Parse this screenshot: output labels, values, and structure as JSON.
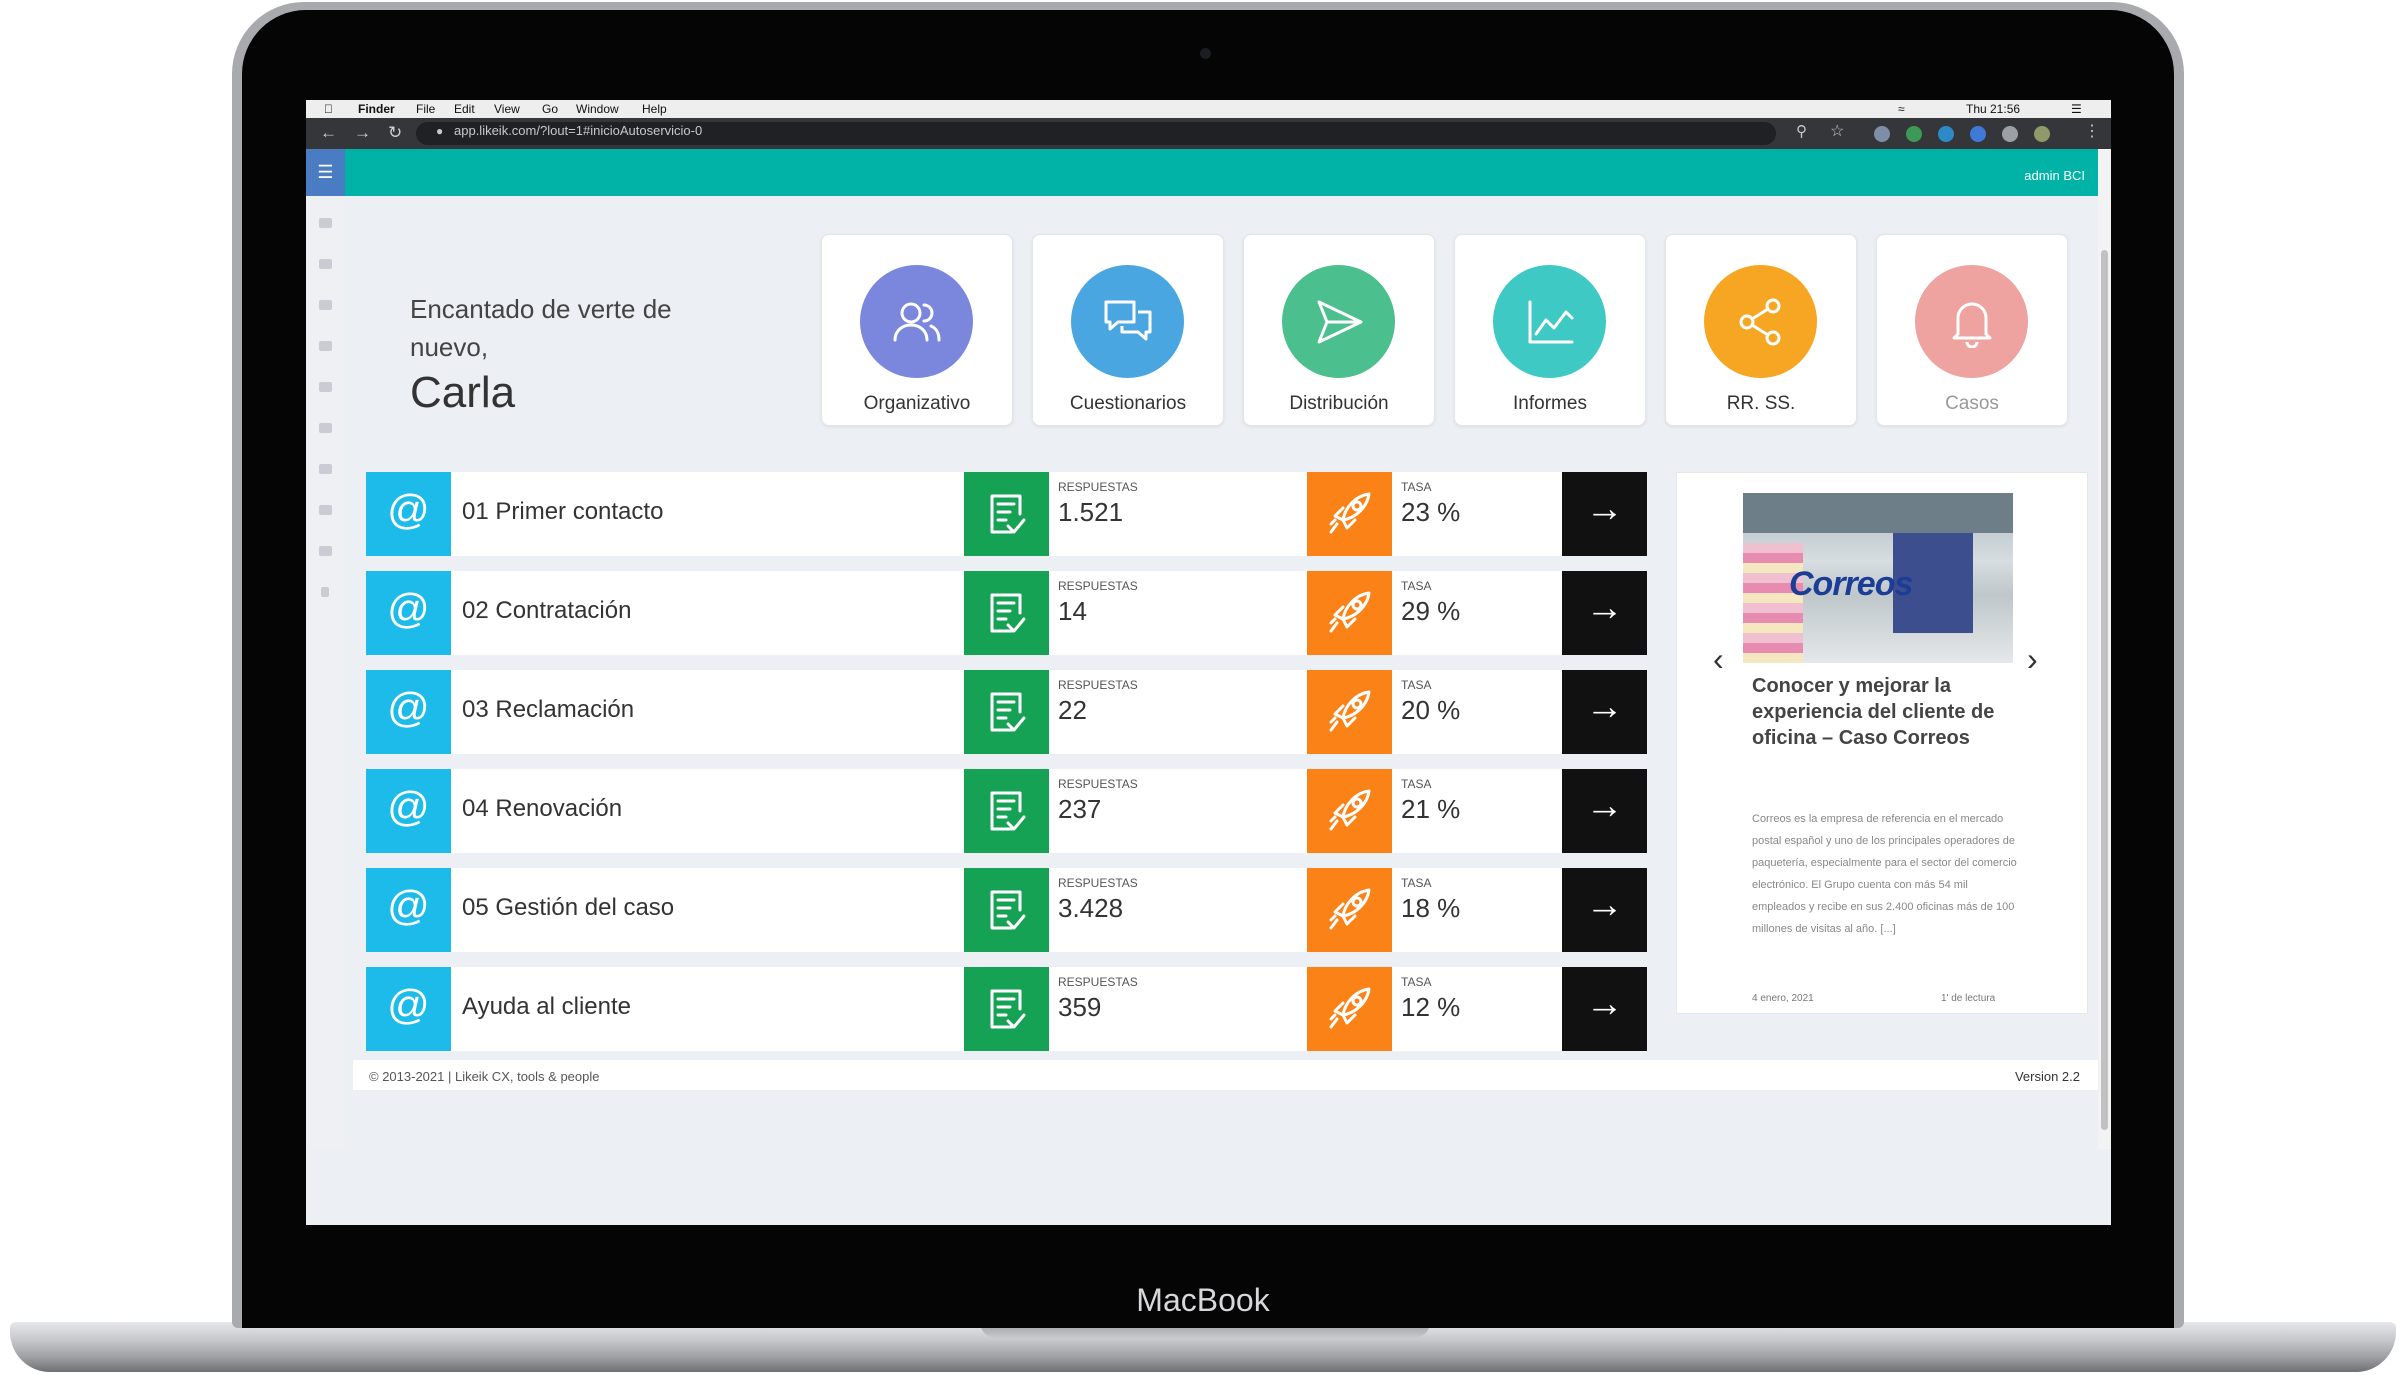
{
  "device": {
    "brand_label": "MacBook"
  },
  "macos_menu": {
    "items": [
      "Finder",
      "File",
      "Edit",
      "View",
      "Go",
      "Window",
      "Help"
    ],
    "clock": "Thu 21:56"
  },
  "browser": {
    "url": "app.likeik.com/?lout=1#inicioAutoservicio-0"
  },
  "header": {
    "user": "admin BCI",
    "accent_color": "#00b3a6"
  },
  "greeting": {
    "line": "Encantado de verte de nuevo,",
    "name": "Carla"
  },
  "tiles": [
    {
      "label": "Organizativo",
      "icon": "users-icon",
      "color": "#7b87dc"
    },
    {
      "label": "Cuestionarios",
      "icon": "chat-icon",
      "color": "#4aa6e0"
    },
    {
      "label": "Distribución",
      "icon": "send-icon",
      "color": "#4bbf8d"
    },
    {
      "label": "Informes",
      "icon": "chart-line-icon",
      "color": "#3fc9c5"
    },
    {
      "label": "RR. SS.",
      "icon": "share-icon",
      "color": "#f6a623"
    },
    {
      "label": "Casos",
      "icon": "bell-icon",
      "color": "#eea3a0",
      "disabled": true
    }
  ],
  "surveys": {
    "responses_label": "RESPUESTAS",
    "rate_label": "TASA",
    "rows": [
      {
        "name": "01 Primer contacto",
        "responses": "1.521",
        "rate": "23 %"
      },
      {
        "name": "02 Contratación",
        "responses": "14",
        "rate": "29 %"
      },
      {
        "name": "03 Reclamación",
        "responses": "22",
        "rate": "20 %"
      },
      {
        "name": "04 Renovación",
        "responses": "237",
        "rate": "21 %"
      },
      {
        "name": "05 Gestión del caso",
        "responses": "3.428",
        "rate": "18 %"
      },
      {
        "name": "Ayuda al cliente",
        "responses": "359",
        "rate": "12 %"
      }
    ]
  },
  "news": {
    "image_logo": "Correos",
    "title": "Conocer y mejorar la experiencia del cliente de oficina – Caso Correos",
    "excerpt": "Correos es la empresa de referencia en el mercado postal español y uno de los principales operadores de paquetería, especialmente para el sector del comercio electrónico. El Grupo cuenta con más 54 mil empleados y recibe en sus 2.400 oficinas más de 100 millones de visitas al año. [...]",
    "date": "4 enero, 2021",
    "read_time": "1' de lectura"
  },
  "footer": {
    "copyright": "© 2013-2021 | Likeik CX, tools & people",
    "version": "Version 2.2"
  }
}
